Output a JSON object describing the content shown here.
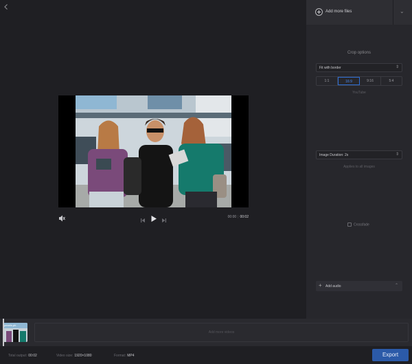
{
  "panel": {
    "add_files_label": "Add more files",
    "crop_title": "Crop options",
    "crop_mode": "Fit with border",
    "ratios": [
      "1:1",
      "16:9",
      "9:16",
      "5:4"
    ],
    "active_ratio": "16:9",
    "ratio_hint": "YouTube",
    "image_duration": "Image Duration: 2s",
    "duration_hint": "Applies to all images",
    "crossfade_label": "Crossfade",
    "add_audio_label": "Add audio"
  },
  "player": {
    "current_time": "00:00",
    "duration": "00:02"
  },
  "timeline": {
    "clip_label": "pexels-ph",
    "add_more_label": "Add more videos"
  },
  "footer": {
    "total_length_label": "Total output:",
    "total_length_value": "00:02",
    "size_label": "Video size:",
    "size_value": "1920×1080",
    "format_label": "Format:",
    "format_value": "MP4",
    "export_label": "Export"
  },
  "colors": {
    "accent": "#2b5aa8",
    "active_ratio": "#2f6fd6",
    "panel_bg": "#27272c",
    "workspace_bg": "#1f1f23"
  }
}
